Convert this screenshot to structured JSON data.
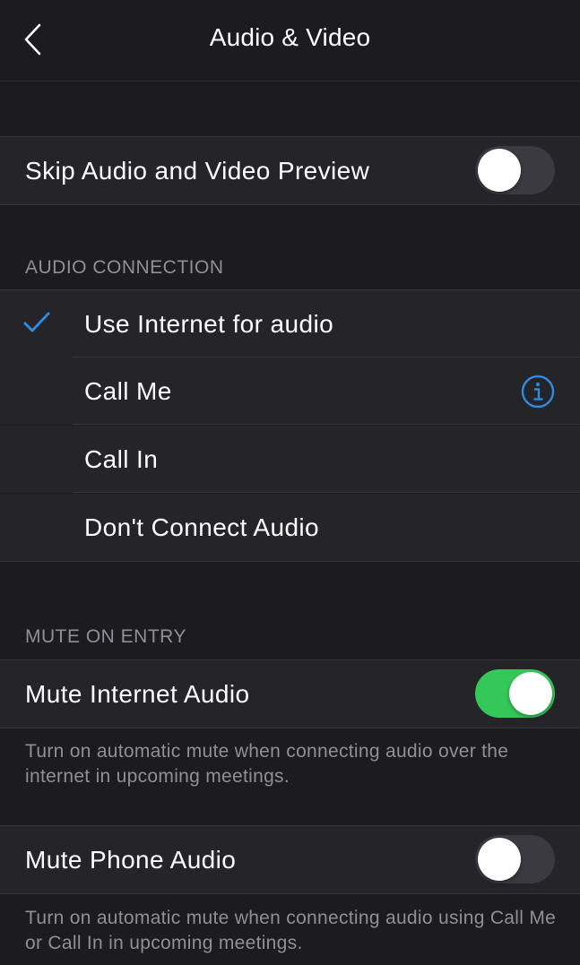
{
  "header": {
    "title": "Audio & Video",
    "back_icon": "chevron-left-icon"
  },
  "preview": {
    "label": "Skip Audio and Video Preview",
    "toggle_on": false
  },
  "audio_connection": {
    "header": "AUDIO CONNECTION",
    "options": [
      {
        "label": "Use Internet for audio",
        "selected": true
      },
      {
        "label": "Call Me",
        "selected": false,
        "info_icon": "info-icon"
      },
      {
        "label": "Call In",
        "selected": false
      },
      {
        "label": "Don't Connect Audio",
        "selected": false
      }
    ]
  },
  "mute_on_entry": {
    "header": "MUTE ON ENTRY",
    "internet": {
      "label": "Mute Internet Audio",
      "toggle_on": true,
      "description": "Turn on automatic mute when connecting audio over the internet in upcoming meetings."
    },
    "phone": {
      "label": "Mute Phone Audio",
      "toggle_on": false,
      "description": "Turn on automatic mute when connecting audio using Call Me or Call In in upcoming meetings."
    }
  },
  "colors": {
    "accent_blue": "#2f8ae0",
    "toggle_on": "#34c759",
    "toggle_off": "#3a3a40",
    "background": "#1b1b20",
    "row_background": "#242429"
  }
}
